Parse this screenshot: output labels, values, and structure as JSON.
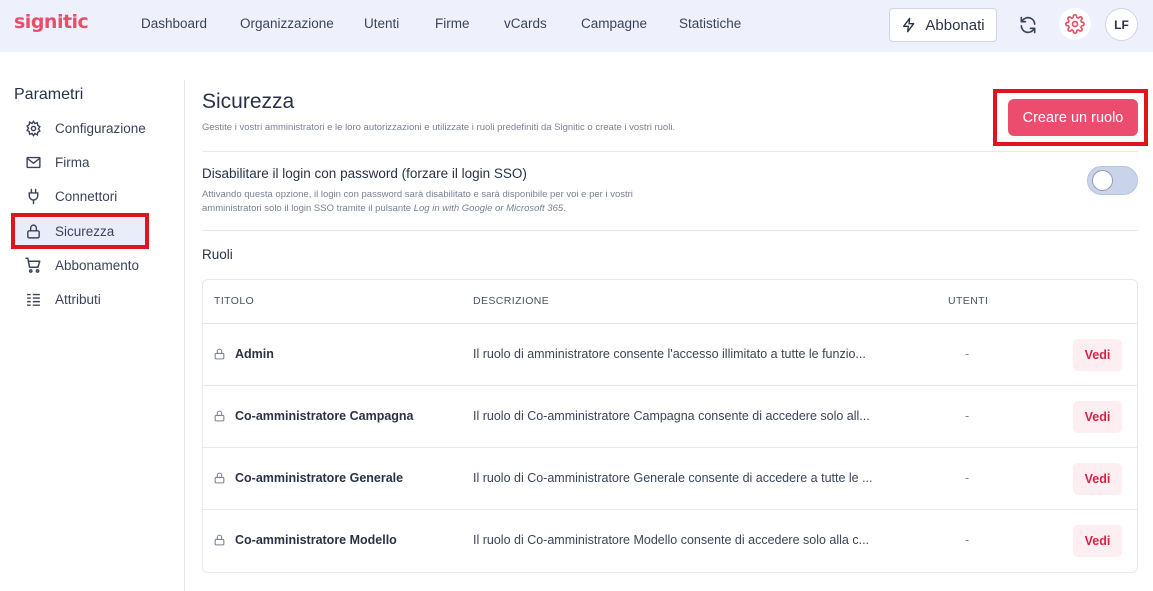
{
  "brand": {
    "logo": "signitic",
    "accent": "#ec4d6f"
  },
  "nav": {
    "items": [
      {
        "label": "Dashboard"
      },
      {
        "label": "Organizzazione"
      },
      {
        "label": "Utenti"
      },
      {
        "label": "Firme"
      },
      {
        "label": "vCards"
      },
      {
        "label": "Campagne"
      },
      {
        "label": "Statistiche"
      }
    ],
    "subscribe_label": "Abbonati",
    "avatar_initials": "LF"
  },
  "sidebar": {
    "title": "Parametri",
    "items": [
      {
        "label": "Configurazione",
        "icon": "gear-icon"
      },
      {
        "label": "Firma",
        "icon": "mail-icon"
      },
      {
        "label": "Connettori",
        "icon": "plug-icon"
      },
      {
        "label": "Sicurezza",
        "icon": "lock-icon",
        "active": true
      },
      {
        "label": "Abbonamento",
        "icon": "cart-icon"
      },
      {
        "label": "Attributi",
        "icon": "list-icon"
      }
    ]
  },
  "main": {
    "title": "Sicurezza",
    "subtitle": "Gestite i vostri amministratori e le loro autorizzazioni e utilizzate i ruoli predefiniti da Signitic o create i vostri ruoli.",
    "create_button": "Creare un ruolo",
    "sso": {
      "title": "Disabilitare il login con password (forzare il login SSO)",
      "desc_prefix": "Attivando questa opzione, il login con password sarà disabilitato e sarà disponibile per voi e per i vostri amministratori solo il login SSO tramite il pulsante ",
      "desc_italic": "Log in with Google or Microsoft 365",
      "desc_suffix": ".",
      "enabled": false
    },
    "roles": {
      "label": "Ruoli",
      "columns": [
        "TITOLO",
        "DESCRIZIONE",
        "UTENTI"
      ],
      "rows": [
        {
          "title": "Admin",
          "description": "Il ruolo di amministratore consente l'accesso illimitato a tutte le funzio...",
          "users": "-",
          "action": "Vedi"
        },
        {
          "title": "Co-amministratore Campagna",
          "description": "Il ruolo di Co-amministratore Campagna consente di accedere solo all...",
          "users": "-",
          "action": "Vedi"
        },
        {
          "title": "Co-amministratore Generale",
          "description": "Il ruolo di Co-amministratore Generale consente di accedere a tutte le ...",
          "users": "-",
          "action": "Vedi"
        },
        {
          "title": "Co-amministratore Modello",
          "description": "Il ruolo di Co-amministratore Modello consente di accedere solo alla c...",
          "users": "-",
          "action": "Vedi"
        }
      ]
    }
  }
}
